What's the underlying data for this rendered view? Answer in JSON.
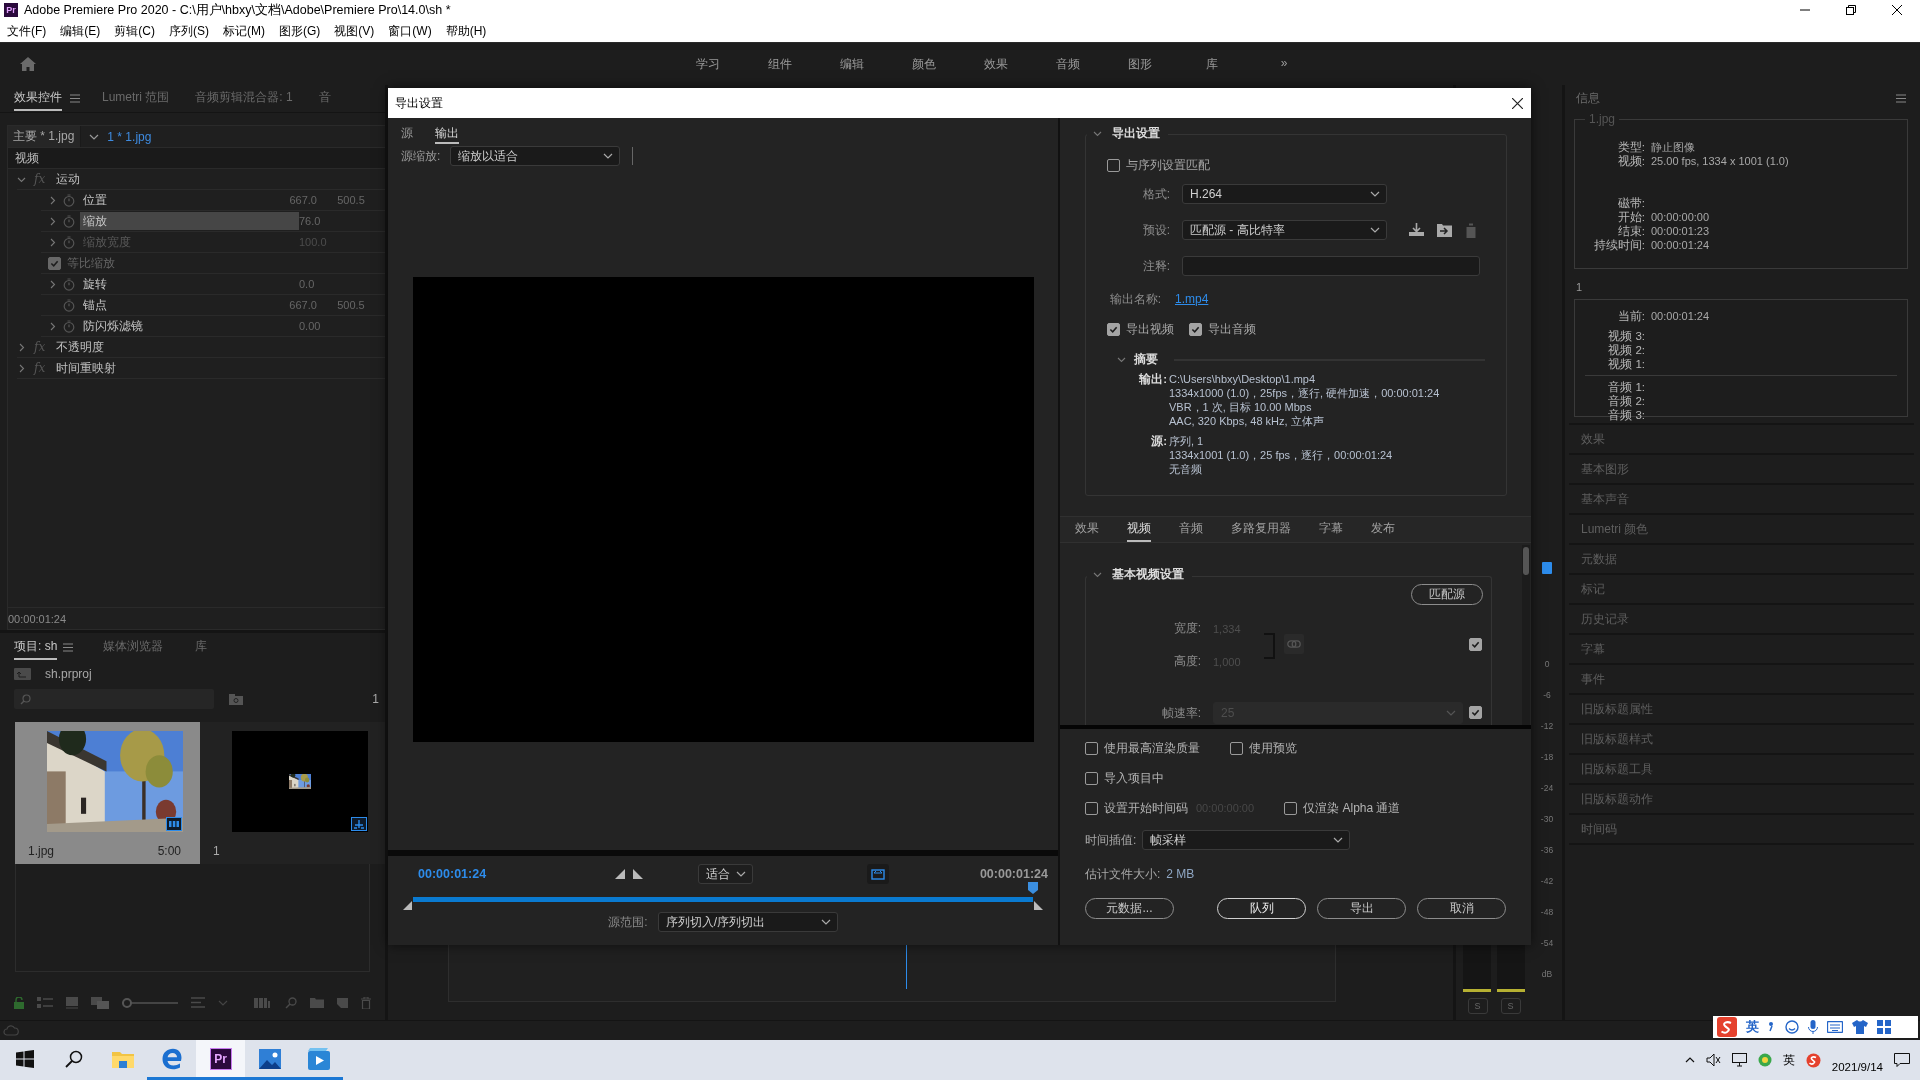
{
  "window": {
    "logo": "Pr",
    "title": "Adobe Premiere Pro 2020 - C:\\用户\\hbxy\\文档\\Adobe\\Premiere Pro\\14.0\\sh *"
  },
  "menu": [
    "文件(F)",
    "编辑(E)",
    "剪辑(C)",
    "序列(S)",
    "标记(M)",
    "图形(G)",
    "视图(V)",
    "窗口(W)",
    "帮助(H)"
  ],
  "workspaces": {
    "tabs": [
      "学习",
      "组件",
      "编辑",
      "颜色",
      "效果",
      "音频",
      "图形",
      "库"
    ],
    "more": "»"
  },
  "effect_controls": {
    "tabs": [
      {
        "label": "效果控件",
        "selected": true
      },
      {
        "label": "Lumetri 范围",
        "selected": false
      },
      {
        "label": "音频剪辑混合器: 1",
        "selected": false
      },
      {
        "label": "音",
        "selected": false
      }
    ],
    "source": "主要 * 1.jpg",
    "clip": "1 * 1.jpg",
    "section": "视频",
    "effects": [
      {
        "badge": "fx",
        "name": "运动",
        "expanded": true,
        "properties": [
          {
            "kind": "param",
            "name": "位置",
            "expandable": true,
            "selected": false,
            "disabled": false,
            "values": [
              "667.0",
              "500.5"
            ]
          },
          {
            "kind": "param",
            "name": "缩放",
            "expandable": true,
            "selected": true,
            "disabled": false,
            "values": [
              "76.0"
            ]
          },
          {
            "kind": "param",
            "name": "缩放宽度",
            "expandable": true,
            "selected": false,
            "disabled": true,
            "values": [
              "100.0"
            ]
          },
          {
            "kind": "checkbox",
            "name": "等比缩放",
            "checked": true
          },
          {
            "kind": "param",
            "name": "旋转",
            "expandable": true,
            "selected": false,
            "disabled": false,
            "values": [
              "0.0"
            ]
          },
          {
            "kind": "param",
            "name": "锚点",
            "expandable": false,
            "selected": false,
            "disabled": false,
            "values": [
              "667.0",
              "500.5"
            ]
          },
          {
            "kind": "param",
            "name": "防闪烁滤镜",
            "expandable": true,
            "selected": false,
            "disabled": false,
            "values": [
              "0.00"
            ]
          }
        ]
      },
      {
        "badge": "fx",
        "name": "不透明度",
        "expanded": false
      },
      {
        "badge": "fx",
        "name": "时间重映射",
        "expanded": false
      }
    ],
    "timecode": "00:00:01:24"
  },
  "project": {
    "tabs": [
      {
        "label": "项目: sh",
        "selected": true
      },
      {
        "label": "媒体浏览器",
        "selected": false
      },
      {
        "label": "库",
        "selected": false
      }
    ],
    "file": "sh.prproj",
    "item_count": "1",
    "items": [
      {
        "kind": "clip",
        "name": "1.jpg",
        "duration": "5:00",
        "selected": true
      },
      {
        "kind": "sequence",
        "name": "1",
        "selected": false
      }
    ],
    "zoom": {
      "level": 0
    }
  },
  "meter": {
    "scale": [
      "0",
      "-6",
      "-12",
      "-18",
      "-24",
      "-30",
      "-36",
      "-42",
      "-48",
      "-54",
      "dB"
    ],
    "solo_buttons": [
      "S",
      "S"
    ]
  },
  "info": {
    "title": "信息",
    "clip": {
      "name": "1.jpg",
      "media_rows": [
        {
          "label": "类型:",
          "value": "静止图像"
        },
        {
          "label": "视频:",
          "value": "25.00 fps, 1334 x 1001 (1.0)"
        }
      ],
      "time_rows": [
        {
          "label": "磁带:"
        },
        {
          "label": "开始:",
          "value": "00:00:00:00"
        },
        {
          "label": "结束:",
          "value": "00:00:01:23"
        },
        {
          "label": "持续时间:",
          "value": "00:00:01:24"
        }
      ]
    },
    "sequence": {
      "name": "1",
      "rows": [
        {
          "label": "当前:",
          "value": "00:00:01:24"
        }
      ],
      "video_tracks": [
        "视频 3:",
        "视频 2:",
        "视频 1:"
      ],
      "audio_tracks": [
        "音频 1:",
        "音频 2:",
        "音频 3:"
      ]
    },
    "panels": [
      "效果",
      "基本图形",
      "基本声音",
      "Lumetri 颜色",
      "元数据",
      "标记",
      "历史记录",
      "字幕",
      "事件",
      "旧版标题属性",
      "旧版标题样式",
      "旧版标题工具",
      "旧版标题动作",
      "时间码"
    ]
  },
  "export_dialog": {
    "title": "导出设置",
    "view_tabs": [
      {
        "label": "源",
        "selected": false
      },
      {
        "label": "输出",
        "selected": true
      }
    ],
    "source_scaling": {
      "label": "源缩放:",
      "value": "缩放以适合"
    },
    "playback": {
      "current_time": "00:00:01:24",
      "zoom": "适合",
      "duration": "00:00:01:24",
      "level": 1,
      "range_label": "源范围:",
      "range": "序列切入/序列切出"
    },
    "export_settings": {
      "title": "导出设置",
      "expanded": true,
      "match_sequence": {
        "label": "与序列设置匹配",
        "checked": false
      },
      "format": {
        "label": "格式:",
        "value": "H.264"
      },
      "preset": {
        "label": "预设:",
        "value": "匹配源 - 高比特率"
      },
      "comments": {
        "label": "注释:"
      },
      "output_name": {
        "label": "输出名称:",
        "value": "1.mp4"
      },
      "export_video": {
        "label": "导出视频",
        "checked": true
      },
      "export_audio": {
        "label": "导出音频",
        "checked": true
      },
      "summary": {
        "title": "摘要",
        "expanded": true,
        "output": {
          "label": "输出:",
          "lines": [
            "C:\\Users\\hbxy\\Desktop\\1.mp4",
            "1334x1000 (1.0)，25fps，逐行, 硬件加速，00:00:01:24",
            "VBR，1 次, 目标 10.00 Mbps",
            "AAC, 320 Kbps, 48 kHz, 立体声"
          ]
        },
        "source": {
          "label": "源:",
          "lines": [
            "序列, 1",
            "1334x1001 (1.0)，25 fps，逐行，00:00:01:24",
            "无音频"
          ]
        }
      }
    },
    "settings_tabs": [
      {
        "label": "效果",
        "selected": false
      },
      {
        "label": "视频",
        "selected": true
      },
      {
        "label": "音频",
        "selected": false
      },
      {
        "label": "多路复用器",
        "selected": false
      },
      {
        "label": "字幕",
        "selected": false
      },
      {
        "label": "发布",
        "selected": false
      }
    ],
    "video_settings": {
      "title": "基本视频设置",
      "expanded": true,
      "match_button": "匹配源",
      "width": {
        "label": "宽度:",
        "value": "1,334",
        "disabled": true
      },
      "height": {
        "label": "高度:",
        "value": "1,000",
        "disabled": true
      },
      "size_checked": true,
      "frame_rate": {
        "label": "帧速率:",
        "value": "25",
        "checked": true,
        "disabled": true
      }
    },
    "options": [
      [
        {
          "label": "使用最高渲染质量",
          "checked": false
        },
        {
          "label": "使用预览",
          "checked": false
        }
      ],
      [
        {
          "label": "导入项目中",
          "checked": false
        }
      ],
      [
        {
          "label": "设置开始时间码",
          "checked": false,
          "value": "00:00:00:00"
        },
        {
          "label": "仅渲染 Alpha 通道",
          "checked": false
        }
      ]
    ],
    "time_interpolation": {
      "label": "时间插值:",
      "value": "帧采样"
    },
    "file_size": {
      "label": "估计文件大小:",
      "value": "2 MB"
    },
    "buttons": [
      {
        "label": "元数据...",
        "kind": "secondary"
      },
      {
        "label": "队列",
        "kind": "default"
      },
      {
        "label": "导出",
        "kind": "normal"
      },
      {
        "label": "取消",
        "kind": "normal"
      }
    ]
  },
  "taskbar": {
    "apps": [
      {
        "kind": "folder",
        "running": false,
        "active": false
      },
      {
        "kind": "browser",
        "running": true,
        "active": false
      },
      {
        "kind": "premiere",
        "label": "Pr",
        "running": true,
        "active": true
      },
      {
        "kind": "photos",
        "running": true,
        "active": false
      },
      {
        "kind": "video",
        "running": true,
        "active": false
      }
    ],
    "ime": "英",
    "date": "2021/9/14"
  },
  "ime_toolbar": {
    "mode": "英"
  }
}
